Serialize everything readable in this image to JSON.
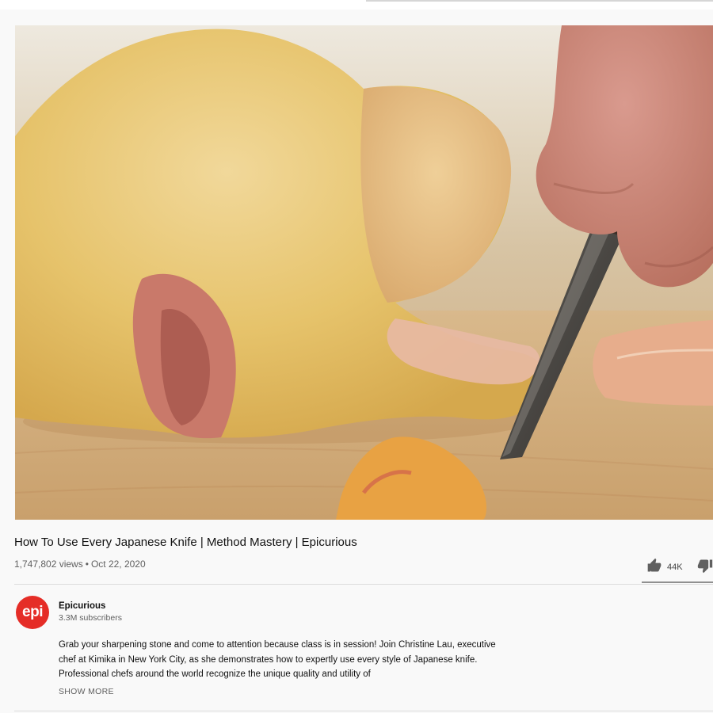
{
  "video": {
    "title": "How To Use Every Japanese Knife | Method Mastery | Epicurious",
    "views": "1,747,802 views",
    "separator": "•",
    "date": "Oct 22, 2020",
    "thumbnail_icon": "raw-chicken-knife-frame"
  },
  "actions": {
    "likes": "44K",
    "like_icon": "thumbs-up-icon",
    "dislike_icon": "thumbs-down-icon"
  },
  "channel": {
    "avatar_text": "epi",
    "avatar_color": "#e52d27",
    "name": "Epicurious",
    "subscribers": "3.3M subscribers"
  },
  "description": {
    "text": "Grab your sharpening stone and come to attention because class is in session! Join Christine Lau, executive chef at Kimika in New York City, as she demonstrates how to expertly use every style of Japanese knife. Professional chefs around the world recognize the unique quality and utility of",
    "show_more": "SHOW MORE"
  }
}
